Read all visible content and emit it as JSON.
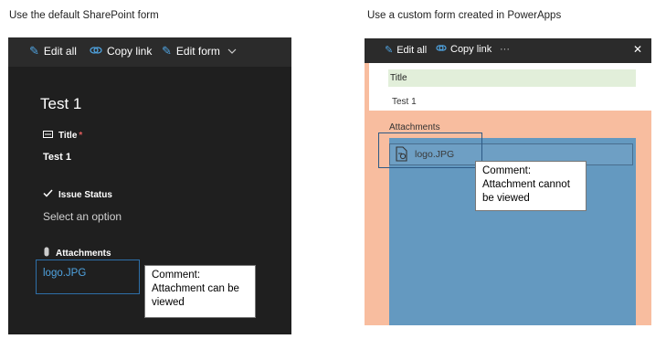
{
  "captions": {
    "left": "Use the default SharePoint form",
    "right": "Use a custom form created in PowerApps"
  },
  "sharepoint_form": {
    "toolbar": {
      "edit_all": "Edit all",
      "copy_link": "Copy link",
      "edit_form": "Edit form"
    },
    "item_title": "Test 1",
    "fields": {
      "title_label": "Title",
      "required_marker": "*",
      "title_value": "Test 1",
      "issue_status_label": "Issue Status",
      "issue_status_placeholder": "Select an option",
      "attachments_label": "Attachments",
      "attachment_file": "logo.JPG"
    },
    "comment": "Comment: Attachment can be viewed"
  },
  "powerapps_form": {
    "toolbar": {
      "edit_all": "Edit all",
      "copy_link": "Copy link",
      "more": "···",
      "close": "✕"
    },
    "title_label": "Title",
    "title_value": "Test 1",
    "attachments_label": "Attachments",
    "attachment_file": "logo.JPG",
    "comment": "Comment: Attachment cannot be viewed"
  },
  "colors": {
    "dark_bg": "#1f1f1f",
    "toolbar_bg": "#2b2b2b",
    "accent_blue": "#4fa3e0",
    "salmon": "#f8bd9f",
    "steel_blue": "#6499c0",
    "light_green": "#e2efda"
  },
  "icons": [
    "edit-icon",
    "link-icon",
    "chevron-down-icon",
    "text-field-icon",
    "check-icon",
    "paperclip-icon",
    "more-icon",
    "close-icon",
    "file-icon"
  ]
}
